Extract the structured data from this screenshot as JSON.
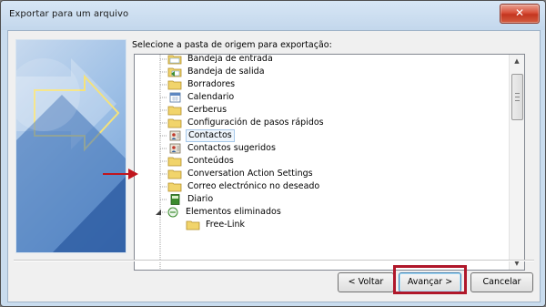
{
  "window": {
    "title": "Exportar para um arquivo",
    "close_label": "✕"
  },
  "prompt": "Selecione a pasta de origem para exportação:",
  "tree": {
    "items": [
      {
        "label": "Bandeja de entrada",
        "icon": "inbox-folder-icon"
      },
      {
        "label": "Bandeja de salida",
        "icon": "outbox-folder-icon"
      },
      {
        "label": "Borradores",
        "icon": "folder-icon"
      },
      {
        "label": "Calendario",
        "icon": "calendar-icon"
      },
      {
        "label": "Cerberus",
        "icon": "folder-icon"
      },
      {
        "label": "Configuración de pasos rápidos",
        "icon": "folder-icon"
      },
      {
        "label": "Contactos",
        "icon": "contacts-icon",
        "selected": true
      },
      {
        "label": "Contactos sugeridos",
        "icon": "contacts-icon"
      },
      {
        "label": "Conteúdos",
        "icon": "folder-icon"
      },
      {
        "label": "Conversation Action Settings",
        "icon": "folder-icon"
      },
      {
        "label": "Correo electrónico no deseado",
        "icon": "folder-icon"
      },
      {
        "label": "Diario",
        "icon": "journal-icon"
      },
      {
        "label": "Elementos eliminados",
        "icon": "deleted-items-icon",
        "expanded": true
      },
      {
        "label": "Free-Link",
        "icon": "folder-icon"
      }
    ]
  },
  "buttons": {
    "back": "< Voltar",
    "next": "Avançar >",
    "cancel": "Cancelar"
  },
  "colors": {
    "highlight_box": "#b0172a",
    "arrow": "#c0161e",
    "selection": "#eef5fc"
  }
}
